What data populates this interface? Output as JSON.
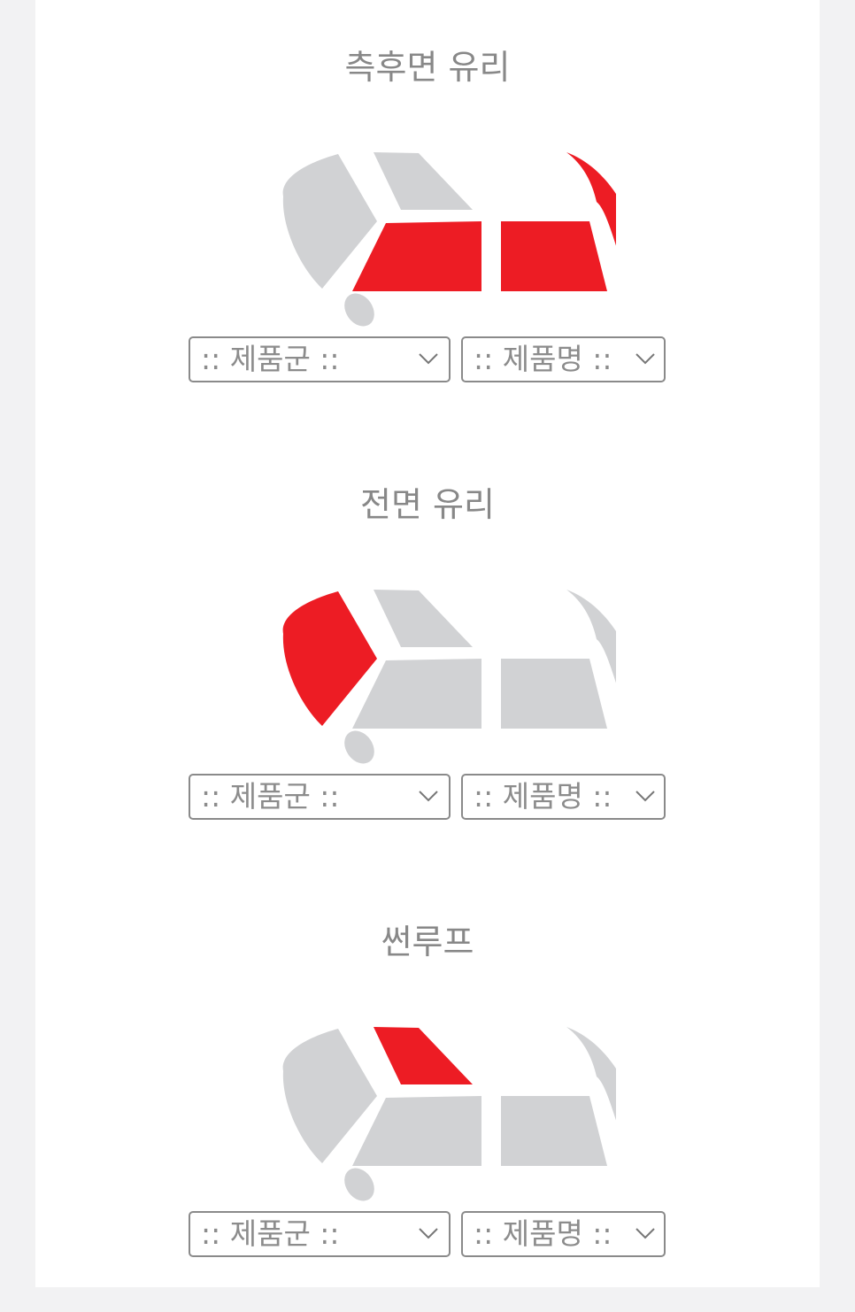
{
  "colors": {
    "highlight": "#ed1c24",
    "inactive": "#d1d2d4",
    "title_text": "#888888",
    "select_border": "#8a8a8a"
  },
  "sections": [
    {
      "title": "측후면 유리",
      "highlighted_glass": [
        "side-front-window",
        "side-rear-window",
        "rear-window"
      ],
      "product_group_select": {
        "value": ":: 제품군 ::",
        "icon": "chevron-down-icon"
      },
      "product_name_select": {
        "value": ":: 제품명 ::",
        "icon": "chevron-down-icon"
      }
    },
    {
      "title": "전면 유리",
      "highlighted_glass": [
        "windshield"
      ],
      "product_group_select": {
        "value": ":: 제품군 ::",
        "icon": "chevron-down-icon"
      },
      "product_name_select": {
        "value": ":: 제품명 ::",
        "icon": "chevron-down-icon"
      }
    },
    {
      "title": "썬루프",
      "highlighted_glass": [
        "sunroof"
      ],
      "product_group_select": {
        "value": ":: 제품군 ::",
        "icon": "chevron-down-icon"
      },
      "product_name_select": {
        "value": ":: 제품명 ::",
        "icon": "chevron-down-icon"
      }
    }
  ]
}
